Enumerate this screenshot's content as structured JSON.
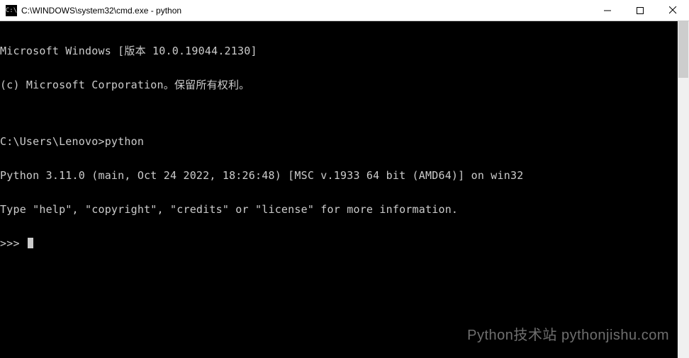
{
  "window": {
    "icon_label": "C:\\",
    "title": "C:\\WINDOWS\\system32\\cmd.exe - python"
  },
  "terminal": {
    "lines": [
      "Microsoft Windows [版本 10.0.19044.2130]",
      "(c) Microsoft Corporation。保留所有权利。",
      "",
      "C:\\Users\\Lenovo>python",
      "Python 3.11.0 (main, Oct 24 2022, 18:26:48) [MSC v.1933 64 bit (AMD64)] on win32",
      "Type \"help\", \"copyright\", \"credits\" or \"license\" for more information."
    ],
    "prompt": ">>> "
  },
  "watermark": "Python技术站  pythonjishu.com"
}
